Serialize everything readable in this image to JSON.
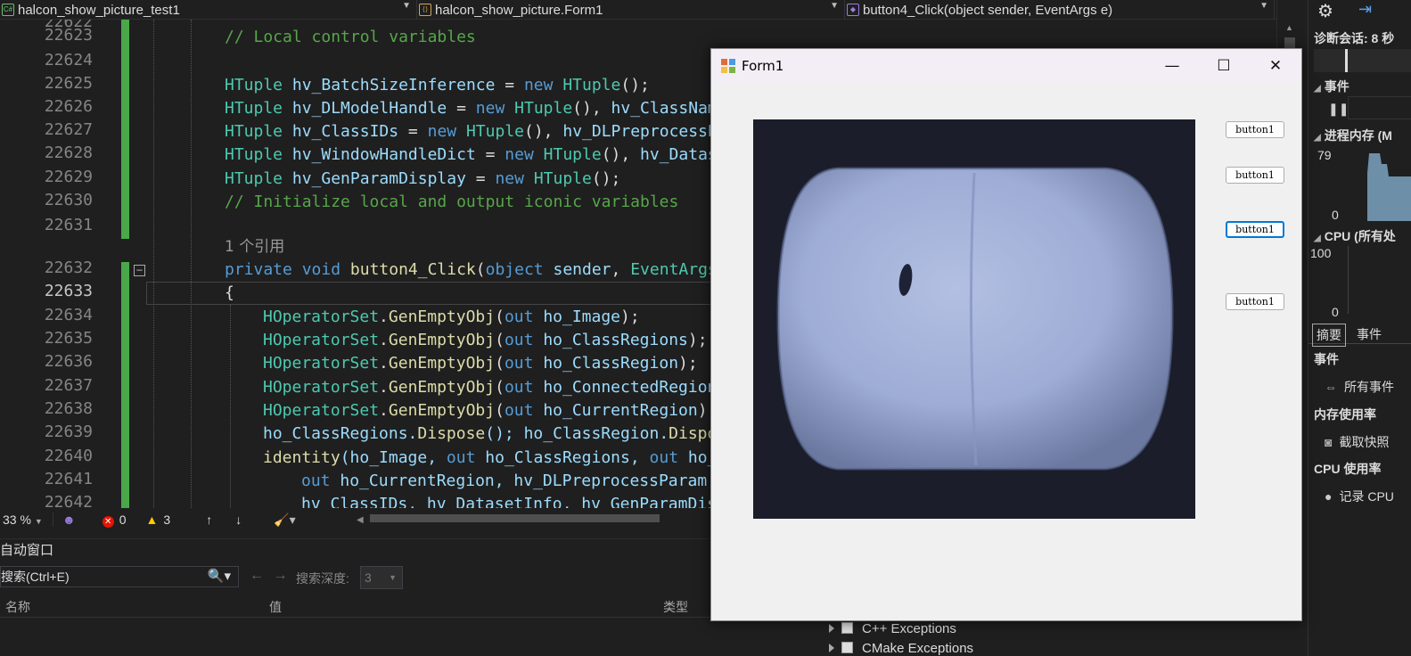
{
  "nav": {
    "project": "halcon_show_picture_test1",
    "class": "halcon_show_picture.Form1",
    "member": "button4_Click(object sender, EventArgs e)"
  },
  "editor": {
    "lines": [
      {
        "num": "22622",
        "y": -8
      },
      {
        "num": "22623"
      },
      {
        "num": "22624"
      },
      {
        "num": "22625"
      },
      {
        "num": "22626"
      },
      {
        "num": "22627"
      },
      {
        "num": "22628"
      },
      {
        "num": "22629"
      },
      {
        "num": "22630"
      },
      {
        "num": "22631"
      },
      {
        "num": "22632"
      },
      {
        "num": "22633"
      },
      {
        "num": "22634"
      },
      {
        "num": "22635"
      },
      {
        "num": "22636"
      },
      {
        "num": "22637"
      },
      {
        "num": "22638"
      },
      {
        "num": "22639"
      },
      {
        "num": "22640"
      },
      {
        "num": "22641"
      },
      {
        "num": "22642"
      }
    ],
    "code": {
      "l22623": "// Local control variables",
      "l22625_type": "HTuple",
      "l22625_var": "hv_BatchSizeInference",
      "l22626_var": "hv_DLModelHandle",
      "l22626_var2": "hv_ClassNam",
      "l22627_var": "hv_ClassIDs",
      "l22627_var2": "hv_DLPreprocessP",
      "l22628_var": "hv_WindowHandleDict",
      "l22628_var2": "hv_Datas",
      "l22629_var": "hv_GenParamDisplay",
      "l22630": "// Initialize local and output iconic variables",
      "ref_hint": "1 个引用",
      "l22632_mod": "private void",
      "l22632_name": "button4_Click",
      "l22632_p1type": "object",
      "l22632_p1": "sender",
      "l22632_p2type": "EventArgs",
      "brace": "{",
      "hop": "HOperatorSet",
      "gen": "GenEmptyObj",
      "out": "out",
      "l22634_arg": "ho_Image",
      "l22635_arg": "ho_ClassRegions",
      "l22636_arg": "ho_ClassRegion",
      "l22637_arg": "ho_ConnectedRegion",
      "l22638_arg": "ho_CurrentRegion",
      "l22639": "ho_ClassRegions.",
      "l22639_m": "Dispose",
      "l22639_b": "(); ho_ClassRegion.",
      "l22639_c": "Dispo",
      "l22640_m": "identity",
      "l22640_a": "(ho_Image, ",
      "l22640_b": " ho_ClassRegions, ",
      "l22640_c": " ho_",
      "l22641_a": " ho_CurrentRegion, hv_DLPreprocessParam,",
      "l22642": "hv_ClassIDs, hv_DatasetInfo, hv_GenParamDis"
    }
  },
  "status": {
    "zoom": "33 %",
    "errors": "0",
    "warnings": "3"
  },
  "autos": {
    "title": "自动窗口",
    "search_placeholder": "搜索(Ctrl+E)",
    "depth_label": "搜索深度:",
    "depth_value": "3",
    "col_name": "名称",
    "col_value": "值",
    "col_type": "类型"
  },
  "exceptions": [
    "C++ Exceptions",
    "CMake Exceptions"
  ],
  "diagnostics": {
    "session": "诊断会话: 8 秒",
    "events": "事件",
    "memory": "进程内存 (M",
    "mem_max": "79",
    "mem_min": "0",
    "cpu": "CPU (所有处",
    "cpu_max": "100",
    "cpu_min": "0",
    "tab_summary": "摘要",
    "tab_events": "事件",
    "sec_events": "事件",
    "all_events": "所有事件",
    "sec_memory": "内存使用率",
    "snapshot": "截取快照",
    "sec_cpu": "CPU 使用率",
    "record_cpu": "记录 CPU"
  },
  "form": {
    "title": "Form1",
    "buttons": [
      "button1",
      "button1",
      "button1",
      "button1"
    ]
  }
}
